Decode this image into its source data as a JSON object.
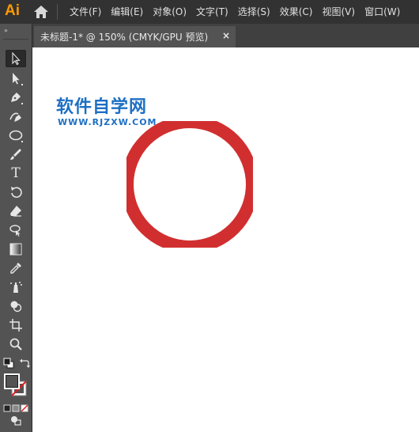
{
  "app": {
    "logo": "Ai",
    "menu": [
      "文件(F)",
      "编辑(E)",
      "对象(O)",
      "文字(T)",
      "选择(S)",
      "效果(C)",
      "视图(V)",
      "窗口(W)"
    ]
  },
  "toolbar": {
    "grip": "»",
    "tools": [
      {
        "name": "selection-tool",
        "icon": "selection-arrow-icon",
        "active": true
      },
      {
        "name": "direct-selection-tool",
        "icon": "direct-selection-arrow-icon"
      },
      {
        "name": "pen-tool",
        "icon": "pen-icon"
      },
      {
        "name": "curvature-tool",
        "icon": "curvature-pen-icon"
      },
      {
        "name": "ellipse-tool",
        "icon": "ellipse-icon"
      },
      {
        "name": "paintbrush-tool",
        "icon": "paintbrush-icon"
      },
      {
        "name": "type-tool",
        "icon": "type-icon"
      },
      {
        "name": "rotate-tool",
        "icon": "rotate-icon"
      },
      {
        "name": "eraser-tool",
        "icon": "eraser-icon"
      },
      {
        "name": "lasso-tool",
        "icon": "lasso-icon"
      },
      {
        "name": "gradient-tool",
        "icon": "gradient-icon"
      },
      {
        "name": "eyedropper-tool",
        "icon": "eyedropper-icon"
      },
      {
        "name": "symbol-sprayer-tool",
        "icon": "symbol-sprayer-icon"
      },
      {
        "name": "shape-builder-tool",
        "icon": "shape-builder-icon"
      },
      {
        "name": "artboard-tool",
        "icon": "artboard-icon"
      },
      {
        "name": "zoom-tool",
        "icon": "zoom-icon"
      }
    ],
    "type_glyph": "T"
  },
  "document": {
    "tab_title": "未标题-1* @ 150% (CMYK/GPU 预览)",
    "close": "×"
  },
  "canvas": {
    "watermark_title": "软件自学网",
    "watermark_url": "WWW.RJZXW.COM"
  },
  "colors": {
    "ring_stroke": "#d12f2f",
    "watermark": "#1d6fc4",
    "logo": "#ff9a00",
    "fill_swatch": "#ffffff",
    "stroke_swatch": "#1b1b1b"
  }
}
